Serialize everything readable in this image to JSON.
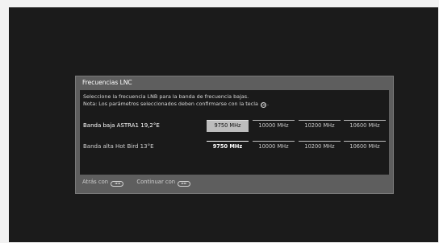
{
  "dialog": {
    "title": "Frecuencias LNC",
    "info_line1": "Seleccione la frecuencia LNB para la banda de frecuencia bajas.",
    "info_line2_before": "Nota: Los parámetros seleccionados deben confirmarse con la tecla",
    "info_line2_after": ".",
    "ok_key_glyph": "OK"
  },
  "rows": [
    {
      "label": "Banda baja ASTRA1 19,2°E",
      "options": [
        "9750 MHz",
        "10000 MHz",
        "10200 MHz",
        "10600 MHz"
      ],
      "selected_option": "9750 MHz"
    },
    {
      "label": "Banda alta Hot Bird 13°E",
      "options": [
        "9750 MHz",
        "10000 MHz",
        "10200 MHz",
        "10600 MHz"
      ],
      "selected_option": "9750 MHz"
    }
  ],
  "footer": {
    "back_label": "Atrás con",
    "back_key_glyph": "◄◄",
    "continue_label": "Continuar con",
    "continue_key_glyph": "►►"
  }
}
